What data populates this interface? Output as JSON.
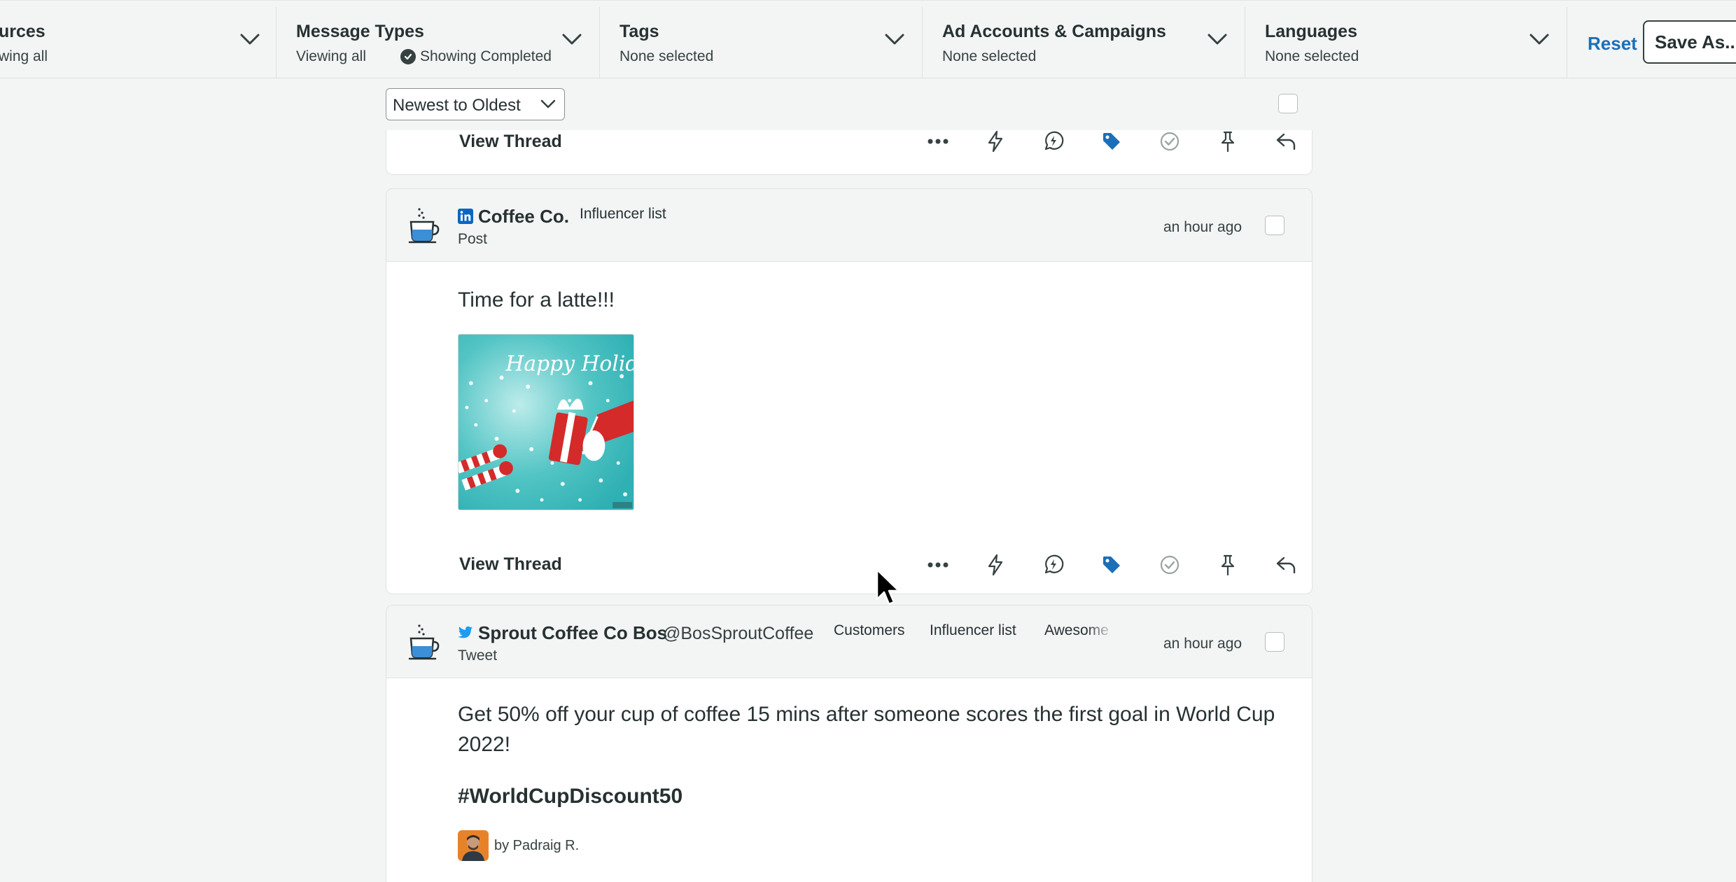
{
  "filters": [
    {
      "title": "urces",
      "subtitle": "wing all"
    },
    {
      "title": "Message Types",
      "subtitle": "Viewing all",
      "subtitle2": "Showing Completed"
    },
    {
      "title": "Tags",
      "subtitle": "None selected"
    },
    {
      "title": "Ad Accounts & Campaigns",
      "subtitle": "None selected"
    },
    {
      "title": "Languages",
      "subtitle": "None selected"
    }
  ],
  "actions": {
    "reset_label": "Reset",
    "save_label": "Save As..."
  },
  "sort": {
    "selected": "Newest to Oldest"
  },
  "prev_card": {
    "view_thread": "View Thread"
  },
  "card1": {
    "network": "linkedin",
    "author": "Coffee Co.",
    "tags": [
      "Influencer list"
    ],
    "type": "Post",
    "time": "an hour ago",
    "text": "Time for a latte!!!",
    "image_text": "Happy Holidays!",
    "view_thread": "View Thread"
  },
  "card2": {
    "network": "twitter",
    "author": "Sprout Coffee Co Bos",
    "handle": "@BosSproutCoffee",
    "tags": [
      "Customers",
      "Influencer list",
      "Awesome Peop"
    ],
    "type": "Tweet",
    "time": "an hour ago",
    "text_line1": "Get 50% off your cup of coffee 15 mins after someone scores the first goal in World Cup",
    "text_line2": "2022!",
    "hashtag": "#WorldCupDiscount50",
    "byline": "by Padraig R."
  },
  "action_icons": [
    "more-icon",
    "bolt-icon",
    "spike-alert-icon",
    "tag-icon",
    "complete-icon",
    "pin-icon",
    "reply-icon"
  ],
  "colors": {
    "accent": "#1b6fb8",
    "linkedin": "#0a66c2",
    "twitter": "#1d9bf0",
    "text": "#273132",
    "background": "#f3f4f4"
  }
}
